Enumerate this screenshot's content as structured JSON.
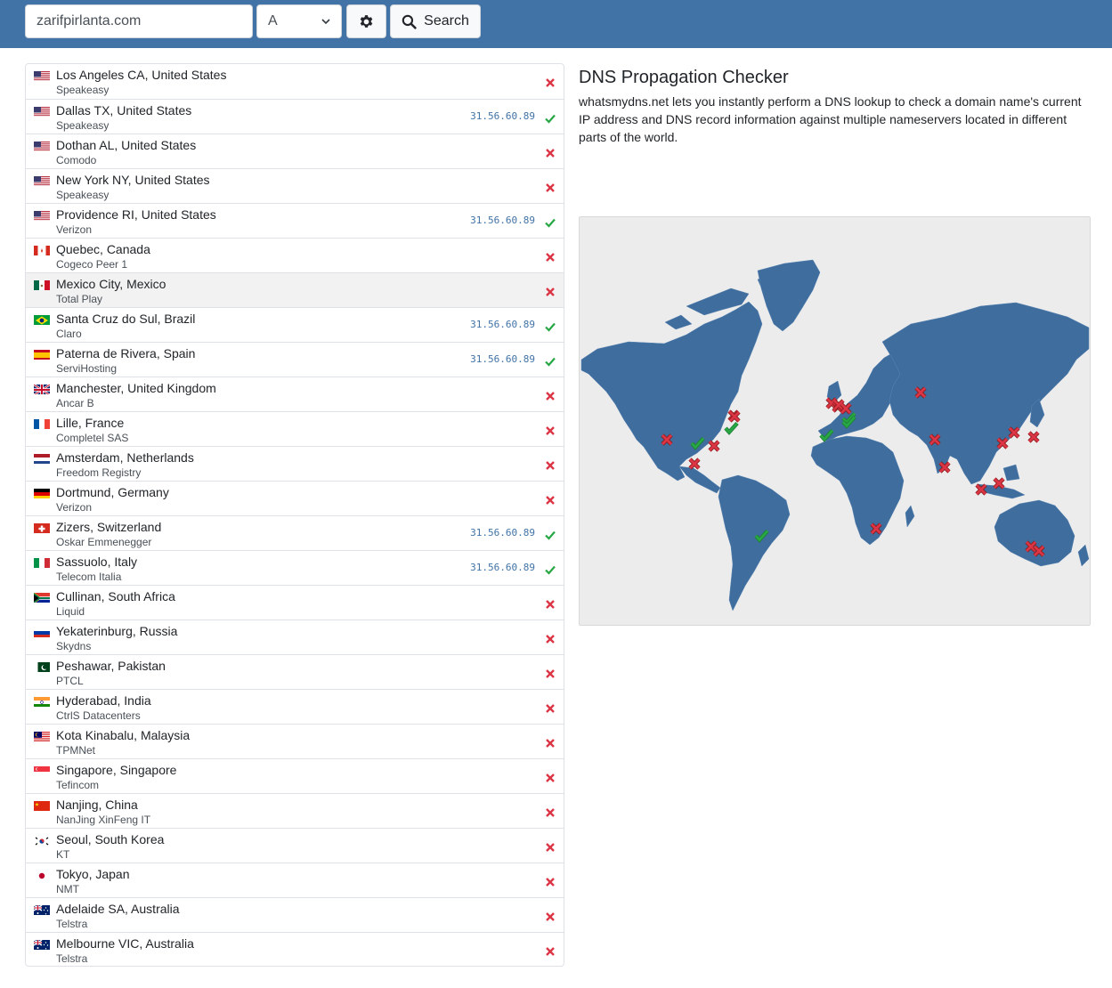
{
  "search": {
    "domain": "zarifpirlanta.com",
    "record_type": "A",
    "button_label": "Search"
  },
  "main": {
    "title": "DNS Propagation Checker",
    "description": "whatsmydns.net lets you instantly perform a DNS lookup to check a domain name's current IP address and DNS record information against multiple nameservers located in different parts of the world."
  },
  "colors": {
    "header": "#4173a6",
    "ok": "#28a745",
    "fail": "#dc3545",
    "land": "#3f6e9e",
    "ocean": "#ececec"
  },
  "results": [
    {
      "location": "Los Angeles CA, United States",
      "provider": "Speakeasy",
      "ip": "",
      "status": "fail",
      "flag": "us"
    },
    {
      "location": "Dallas TX, United States",
      "provider": "Speakeasy",
      "ip": "31.56.60.89",
      "status": "ok",
      "flag": "us"
    },
    {
      "location": "Dothan AL, United States",
      "provider": "Comodo",
      "ip": "",
      "status": "fail",
      "flag": "us"
    },
    {
      "location": "New York NY, United States",
      "provider": "Speakeasy",
      "ip": "",
      "status": "fail",
      "flag": "us"
    },
    {
      "location": "Providence RI, United States",
      "provider": "Verizon",
      "ip": "31.56.60.89",
      "status": "ok",
      "flag": "us"
    },
    {
      "location": "Quebec, Canada",
      "provider": "Cogeco Peer 1",
      "ip": "",
      "status": "fail",
      "flag": "ca"
    },
    {
      "location": "Mexico City, Mexico",
      "provider": "Total Play",
      "ip": "",
      "status": "fail",
      "flag": "mx"
    },
    {
      "location": "Santa Cruz do Sul, Brazil",
      "provider": "Claro",
      "ip": "31.56.60.89",
      "status": "ok",
      "flag": "br"
    },
    {
      "location": "Paterna de Rivera, Spain",
      "provider": "ServiHosting",
      "ip": "31.56.60.89",
      "status": "ok",
      "flag": "es"
    },
    {
      "location": "Manchester, United Kingdom",
      "provider": "Ancar B",
      "ip": "",
      "status": "fail",
      "flag": "gb"
    },
    {
      "location": "Lille, France",
      "provider": "Completel SAS",
      "ip": "",
      "status": "fail",
      "flag": "fr"
    },
    {
      "location": "Amsterdam, Netherlands",
      "provider": "Freedom Registry",
      "ip": "",
      "status": "fail",
      "flag": "nl"
    },
    {
      "location": "Dortmund, Germany",
      "provider": "Verizon",
      "ip": "",
      "status": "fail",
      "flag": "de"
    },
    {
      "location": "Zizers, Switzerland",
      "provider": "Oskar Emmenegger",
      "ip": "31.56.60.89",
      "status": "ok",
      "flag": "ch"
    },
    {
      "location": "Sassuolo, Italy",
      "provider": "Telecom Italia",
      "ip": "31.56.60.89",
      "status": "ok",
      "flag": "it"
    },
    {
      "location": "Cullinan, South Africa",
      "provider": "Liquid",
      "ip": "",
      "status": "fail",
      "flag": "za"
    },
    {
      "location": "Yekaterinburg, Russia",
      "provider": "Skydns",
      "ip": "",
      "status": "fail",
      "flag": "ru"
    },
    {
      "location": "Peshawar, Pakistan",
      "provider": "PTCL",
      "ip": "",
      "status": "fail",
      "flag": "pk"
    },
    {
      "location": "Hyderabad, India",
      "provider": "CtrlS Datacenters",
      "ip": "",
      "status": "fail",
      "flag": "in"
    },
    {
      "location": "Kota Kinabalu, Malaysia",
      "provider": "TPMNet",
      "ip": "",
      "status": "fail",
      "flag": "my"
    },
    {
      "location": "Singapore, Singapore",
      "provider": "Tefincom",
      "ip": "",
      "status": "fail",
      "flag": "sg"
    },
    {
      "location": "Nanjing, China",
      "provider": "NanJing XinFeng IT",
      "ip": "",
      "status": "fail",
      "flag": "cn"
    },
    {
      "location": "Seoul, South Korea",
      "provider": "KT",
      "ip": "",
      "status": "fail",
      "flag": "kr"
    },
    {
      "location": "Tokyo, Japan",
      "provider": "NMT",
      "ip": "",
      "status": "fail",
      "flag": "jp"
    },
    {
      "location": "Adelaide SA, Australia",
      "provider": "Telstra",
      "ip": "",
      "status": "fail",
      "flag": "au"
    },
    {
      "location": "Melbourne VIC, Australia",
      "provider": "Telstra",
      "ip": "",
      "status": "fail",
      "flag": "au"
    }
  ],
  "highlighted_row": 6
}
